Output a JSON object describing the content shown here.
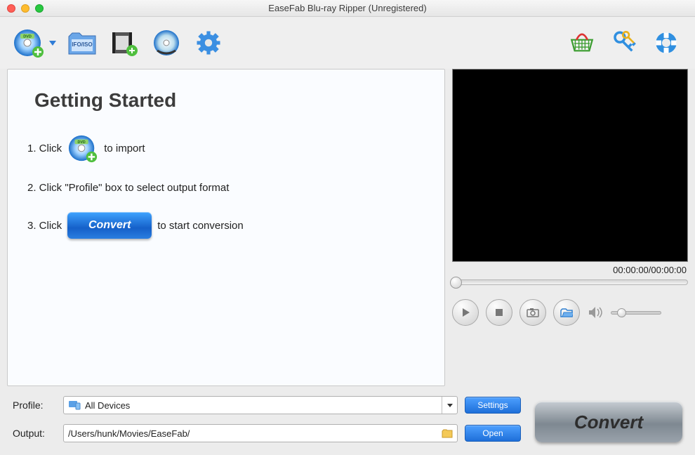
{
  "window": {
    "title": "EaseFab Blu-ray Ripper (Unregistered)"
  },
  "getting_started": {
    "heading": "Getting Started",
    "step1_a": "1. Click",
    "step1_b": "to import",
    "step2": "2. Click \"Profile\" box to select output format",
    "step3_a": "3. Click",
    "step3_btn": "Convert",
    "step3_b": "to start conversion"
  },
  "player": {
    "timecode": "00:00:00/00:00:00"
  },
  "bottom": {
    "profile_label": "Profile:",
    "profile_value": "All Devices",
    "settings_btn": "Settings",
    "output_label": "Output:",
    "output_value": "/Users/hunk/Movies/EaseFab/",
    "open_btn": "Open",
    "convert_btn": "Convert"
  }
}
